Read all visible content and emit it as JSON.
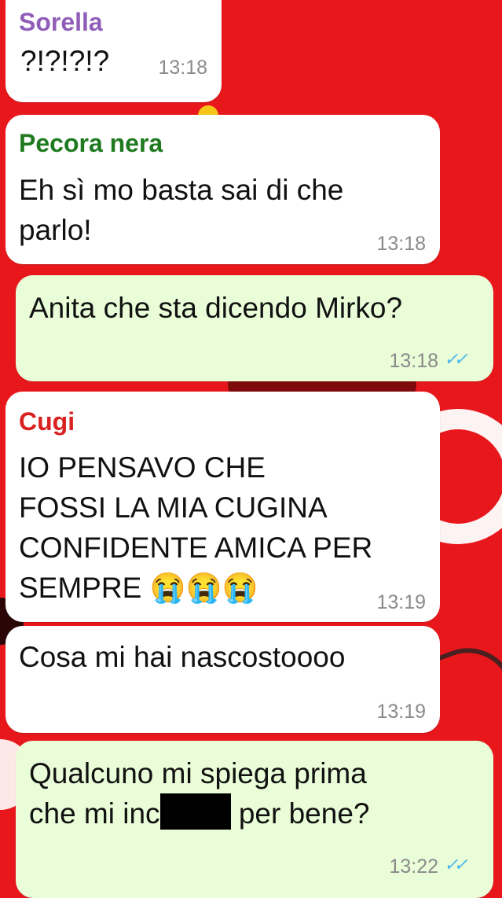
{
  "messages": [
    {
      "sender": "Sorella",
      "sender_color": "#8f5eb8",
      "text": "?!?!?!?",
      "time": "13:18"
    },
    {
      "sender": "Pecora nera",
      "sender_color": "#1f7a1f",
      "text": "Eh sì mo basta sai di che\nparlo!",
      "time": "13:18"
    },
    {
      "text": "Anita che sta dicendo Mirko?",
      "time": "13:18",
      "status": "read"
    },
    {
      "sender": "Cugi",
      "sender_color": "#d9211f",
      "text": "IO PENSAVO CHE\nFOSSI LA MIA CUGINA\nCONFIDENTE AMICA PER\nSEMPRE 😭😭😭",
      "time": "13:19"
    },
    {
      "text": "Cosa mi hai nascostoooo",
      "time": "13:19"
    },
    {
      "text_before": "Qualcuno mi spiega prima\nche mi inc",
      "text_after": "per bene?",
      "time": "13:22",
      "status": "read"
    }
  ],
  "icons": {
    "read_receipt": "double-check-icon",
    "redaction": "censor-bar"
  },
  "colors": {
    "background": "#e8171b",
    "incoming": "#ffffff",
    "outgoing": "#e9fdd8",
    "ticks": "#4fb6ec"
  }
}
